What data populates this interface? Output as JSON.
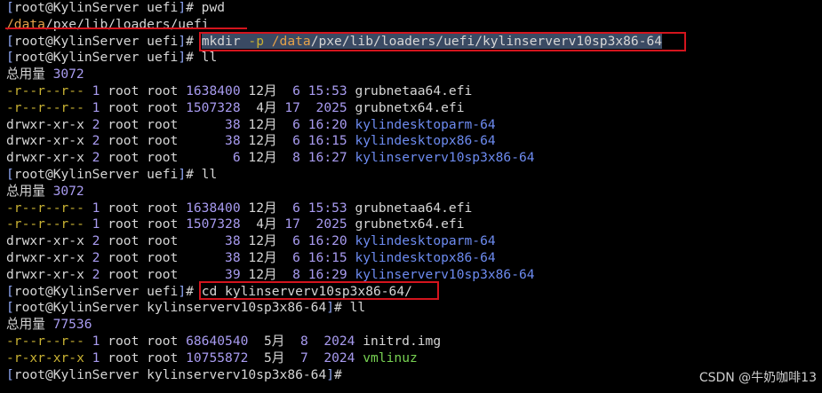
{
  "watermark": "CSDN @牛奶咖啡13",
  "colors": {
    "background": "#000000",
    "text": "#d6d6d6",
    "prompt_bracket": "#8fa7f5",
    "number": "#a89bf0",
    "path_highlight": "#e6a24a",
    "directory": "#6d8bf0",
    "executable": "#77d152",
    "highlight_box": "#d4141d"
  },
  "lines": [
    {
      "segments": [
        {
          "t": "[",
          "c": "bracket"
        },
        {
          "t": "root@KylinServer uefi",
          "c": "plain"
        },
        {
          "t": "]",
          "c": "bracket"
        },
        {
          "t": "# pwd",
          "c": "plain"
        }
      ]
    },
    {
      "segments": [
        {
          "t": "/data",
          "c": "orange"
        },
        {
          "t": "/pxe/lib/loaders/uefi",
          "c": "plain"
        }
      ]
    },
    {
      "segments": [
        {
          "t": "[",
          "c": "bracket"
        },
        {
          "t": "root@KylinServer uefi",
          "c": "plain"
        },
        {
          "t": "]",
          "c": "bracket"
        },
        {
          "t": "# ",
          "c": "plain"
        },
        {
          "t": "mkdir ",
          "c": "plain",
          "sel": true
        },
        {
          "t": "-p ",
          "c": "yellow",
          "sel": true
        },
        {
          "t": "/data",
          "c": "orange",
          "sel": true
        },
        {
          "t": "/pxe/lib/loaders/uefi/kylinserverv10sp3x86-64",
          "c": "plain",
          "sel": true
        }
      ]
    },
    {
      "segments": [
        {
          "t": "[",
          "c": "bracket"
        },
        {
          "t": "root@KylinServer uefi",
          "c": "plain"
        },
        {
          "t": "]",
          "c": "bracket"
        },
        {
          "t": "# ll",
          "c": "plain"
        }
      ]
    },
    {
      "segments": [
        {
          "t": "总用量 ",
          "c": "plain"
        },
        {
          "t": "3072",
          "c": "purple"
        }
      ]
    },
    {
      "segments": [
        {
          "t": "-r--r--r-- ",
          "c": "yellow"
        },
        {
          "t": "1",
          "c": "purple"
        },
        {
          "t": " root root ",
          "c": "plain"
        },
        {
          "t": "1638400",
          "c": "purple"
        },
        {
          "t": " 12月  ",
          "c": "plain"
        },
        {
          "t": "6",
          "c": "purple"
        },
        {
          "t": " ",
          "c": "plain"
        },
        {
          "t": "15:53",
          "c": "purple"
        },
        {
          "t": " grubnetaa64.efi",
          "c": "plain"
        }
      ]
    },
    {
      "segments": [
        {
          "t": "-r--r--r-- ",
          "c": "yellow"
        },
        {
          "t": "1",
          "c": "purple"
        },
        {
          "t": " root root ",
          "c": "plain"
        },
        {
          "t": "1507328",
          "c": "purple"
        },
        {
          "t": "  4月 ",
          "c": "plain"
        },
        {
          "t": "17",
          "c": "purple"
        },
        {
          "t": "  ",
          "c": "plain"
        },
        {
          "t": "2025",
          "c": "purple"
        },
        {
          "t": " grubnetx64.efi",
          "c": "plain"
        }
      ]
    },
    {
      "segments": [
        {
          "t": "drwxr-xr-x ",
          "c": "plain"
        },
        {
          "t": "2",
          "c": "purple"
        },
        {
          "t": " root root      ",
          "c": "plain"
        },
        {
          "t": "38",
          "c": "purple"
        },
        {
          "t": " 12月  ",
          "c": "plain"
        },
        {
          "t": "6",
          "c": "purple"
        },
        {
          "t": " ",
          "c": "plain"
        },
        {
          "t": "16:20",
          "c": "purple"
        },
        {
          "t": " ",
          "c": "plain"
        },
        {
          "t": "kylindesktoparm-64",
          "c": "dir"
        }
      ]
    },
    {
      "segments": [
        {
          "t": "drwxr-xr-x ",
          "c": "plain"
        },
        {
          "t": "2",
          "c": "purple"
        },
        {
          "t": " root root      ",
          "c": "plain"
        },
        {
          "t": "38",
          "c": "purple"
        },
        {
          "t": " 12月  ",
          "c": "plain"
        },
        {
          "t": "6",
          "c": "purple"
        },
        {
          "t": " ",
          "c": "plain"
        },
        {
          "t": "16:15",
          "c": "purple"
        },
        {
          "t": " ",
          "c": "plain"
        },
        {
          "t": "kylindesktopx86-64",
          "c": "dir"
        }
      ]
    },
    {
      "segments": [
        {
          "t": "drwxr-xr-x ",
          "c": "plain"
        },
        {
          "t": "2",
          "c": "purple"
        },
        {
          "t": " root root       ",
          "c": "plain"
        },
        {
          "t": "6",
          "c": "purple"
        },
        {
          "t": " 12月  ",
          "c": "plain"
        },
        {
          "t": "8",
          "c": "purple"
        },
        {
          "t": " ",
          "c": "plain"
        },
        {
          "t": "16:27",
          "c": "purple"
        },
        {
          "t": " ",
          "c": "plain"
        },
        {
          "t": "kylinserverv10sp3x86-64",
          "c": "dir"
        }
      ]
    },
    {
      "segments": [
        {
          "t": "[",
          "c": "bracket"
        },
        {
          "t": "root@KylinServer uefi",
          "c": "plain"
        },
        {
          "t": "]",
          "c": "bracket"
        },
        {
          "t": "# ll",
          "c": "plain"
        }
      ]
    },
    {
      "segments": [
        {
          "t": "总用量 ",
          "c": "plain"
        },
        {
          "t": "3072",
          "c": "purple"
        }
      ]
    },
    {
      "segments": [
        {
          "t": "-r--r--r-- ",
          "c": "yellow"
        },
        {
          "t": "1",
          "c": "purple"
        },
        {
          "t": " root root ",
          "c": "plain"
        },
        {
          "t": "1638400",
          "c": "purple"
        },
        {
          "t": " 12月  ",
          "c": "plain"
        },
        {
          "t": "6",
          "c": "purple"
        },
        {
          "t": " ",
          "c": "plain"
        },
        {
          "t": "15:53",
          "c": "purple"
        },
        {
          "t": " grubnetaa64.efi",
          "c": "plain"
        }
      ]
    },
    {
      "segments": [
        {
          "t": "-r--r--r-- ",
          "c": "yellow"
        },
        {
          "t": "1",
          "c": "purple"
        },
        {
          "t": " root root ",
          "c": "plain"
        },
        {
          "t": "1507328",
          "c": "purple"
        },
        {
          "t": "  4月 ",
          "c": "plain"
        },
        {
          "t": "17",
          "c": "purple"
        },
        {
          "t": "  ",
          "c": "plain"
        },
        {
          "t": "2025",
          "c": "purple"
        },
        {
          "t": " grubnetx64.efi",
          "c": "plain"
        }
      ]
    },
    {
      "segments": [
        {
          "t": "drwxr-xr-x ",
          "c": "plain"
        },
        {
          "t": "2",
          "c": "purple"
        },
        {
          "t": " root root      ",
          "c": "plain"
        },
        {
          "t": "38",
          "c": "purple"
        },
        {
          "t": " 12月  ",
          "c": "plain"
        },
        {
          "t": "6",
          "c": "purple"
        },
        {
          "t": " ",
          "c": "plain"
        },
        {
          "t": "16:20",
          "c": "purple"
        },
        {
          "t": " ",
          "c": "plain"
        },
        {
          "t": "kylindesktoparm-64",
          "c": "dir"
        }
      ]
    },
    {
      "segments": [
        {
          "t": "drwxr-xr-x ",
          "c": "plain"
        },
        {
          "t": "2",
          "c": "purple"
        },
        {
          "t": " root root      ",
          "c": "plain"
        },
        {
          "t": "38",
          "c": "purple"
        },
        {
          "t": " 12月  ",
          "c": "plain"
        },
        {
          "t": "6",
          "c": "purple"
        },
        {
          "t": " ",
          "c": "plain"
        },
        {
          "t": "16:15",
          "c": "purple"
        },
        {
          "t": " ",
          "c": "plain"
        },
        {
          "t": "kylindesktopx86-64",
          "c": "dir"
        }
      ]
    },
    {
      "segments": [
        {
          "t": "drwxr-xr-x ",
          "c": "plain"
        },
        {
          "t": "2",
          "c": "purple"
        },
        {
          "t": " root root      ",
          "c": "plain"
        },
        {
          "t": "39",
          "c": "purple"
        },
        {
          "t": " 12月  ",
          "c": "plain"
        },
        {
          "t": "8",
          "c": "purple"
        },
        {
          "t": " ",
          "c": "plain"
        },
        {
          "t": "16:29",
          "c": "purple"
        },
        {
          "t": " ",
          "c": "plain"
        },
        {
          "t": "kylinserverv10sp3x86-64",
          "c": "dir"
        }
      ]
    },
    {
      "segments": [
        {
          "t": "[",
          "c": "bracket"
        },
        {
          "t": "root@KylinServer uefi",
          "c": "plain"
        },
        {
          "t": "]",
          "c": "bracket"
        },
        {
          "t": "# ",
          "c": "plain"
        },
        {
          "t": "cd kylinserverv10sp3x86-64/",
          "c": "plain"
        }
      ]
    },
    {
      "segments": [
        {
          "t": "[",
          "c": "bracket"
        },
        {
          "t": "root@KylinServer kylinserverv10sp3x86-64",
          "c": "plain"
        },
        {
          "t": "]",
          "c": "bracket"
        },
        {
          "t": "# ll",
          "c": "plain"
        }
      ]
    },
    {
      "segments": [
        {
          "t": "总用量 ",
          "c": "plain"
        },
        {
          "t": "77536",
          "c": "purple"
        }
      ]
    },
    {
      "segments": [
        {
          "t": "-r--r--r-- ",
          "c": "yellow"
        },
        {
          "t": "1",
          "c": "purple"
        },
        {
          "t": " root root ",
          "c": "plain"
        },
        {
          "t": "68640540",
          "c": "purple"
        },
        {
          "t": "  5月  ",
          "c": "plain"
        },
        {
          "t": "8",
          "c": "purple"
        },
        {
          "t": "  ",
          "c": "plain"
        },
        {
          "t": "2024",
          "c": "purple"
        },
        {
          "t": " initrd.img",
          "c": "plain"
        }
      ]
    },
    {
      "segments": [
        {
          "t": "-r-xr-xr-x ",
          "c": "yellow"
        },
        {
          "t": "1",
          "c": "purple"
        },
        {
          "t": " root root ",
          "c": "plain"
        },
        {
          "t": "10755872",
          "c": "purple"
        },
        {
          "t": "  5月  ",
          "c": "plain"
        },
        {
          "t": "7",
          "c": "purple"
        },
        {
          "t": "  ",
          "c": "plain"
        },
        {
          "t": "2024",
          "c": "purple"
        },
        {
          "t": " ",
          "c": "plain"
        },
        {
          "t": "vmlinuz",
          "c": "exe"
        }
      ]
    },
    {
      "segments": [
        {
          "t": "[",
          "c": "bracket"
        },
        {
          "t": "root@KylinServer kylinserverv10sp3x86-64",
          "c": "plain"
        },
        {
          "t": "]",
          "c": "bracket"
        },
        {
          "t": "#",
          "c": "plain"
        }
      ]
    }
  ]
}
